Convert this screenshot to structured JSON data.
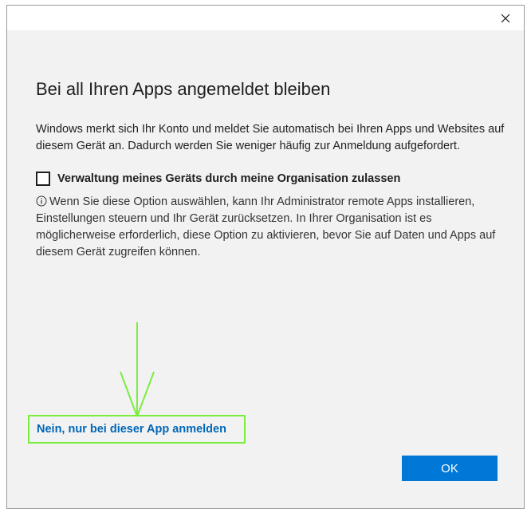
{
  "dialog": {
    "title": "Bei all Ihren Apps angemeldet bleiben",
    "description": "Windows merkt sich Ihr Konto und meldet Sie automatisch bei Ihren Apps und Websites auf diesem Gerät an. Dadurch werden Sie weniger häufig zur Anmeldung aufgefordert.",
    "checkbox": {
      "label": "Verwaltung meines Geräts durch meine Organisation zulassen",
      "checked": false
    },
    "info_text": "Wenn Sie diese Option auswählen, kann Ihr Administrator remote Apps installieren, Einstellungen steuern und Ihr Gerät zurücksetzen. In Ihrer Organisation ist es möglicherweise erforderlich, diese Option zu aktivieren, bevor Sie auf Daten und Apps auf diesem Gerät zugreifen können.",
    "alt_link": "Nein, nur bei dieser App anmelden",
    "ok_label": "OK"
  },
  "icons": {
    "close": "close-icon",
    "info": "info-icon",
    "annotation_arrow": "arrow-down-icon"
  },
  "colors": {
    "link": "#0067b8",
    "primary_button": "#0078d7",
    "highlight": "#7aed3e",
    "dialog_background": "#f2f2f2"
  }
}
